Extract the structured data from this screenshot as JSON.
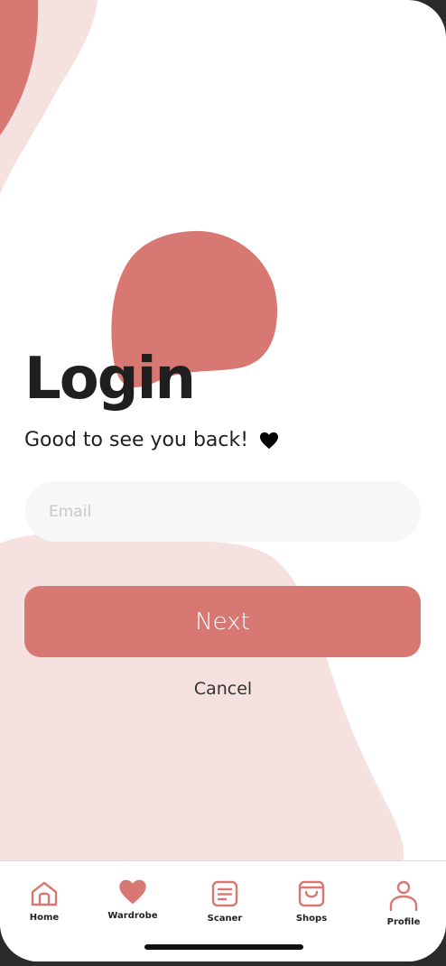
{
  "colors": {
    "accent": "#d87872",
    "blob_light": "#f5e1e0",
    "input_bg": "#f7f7f7",
    "text_dark": "#1f1f1f"
  },
  "login": {
    "title": "Login",
    "subtitle": "Good to see you back!",
    "subtitle_icon": "heart-icon",
    "email_placeholder": "Email",
    "next_label": "Next",
    "cancel_label": "Cancel"
  },
  "tabbar": {
    "items": [
      {
        "label": "Home",
        "icon": "home-icon"
      },
      {
        "label": "Wardrobe",
        "icon": "heart-icon"
      },
      {
        "label": "Scaner",
        "icon": "document-icon"
      },
      {
        "label": "Shops",
        "icon": "shopping-bag-icon"
      },
      {
        "label": "Profile",
        "icon": "user-icon"
      }
    ]
  }
}
